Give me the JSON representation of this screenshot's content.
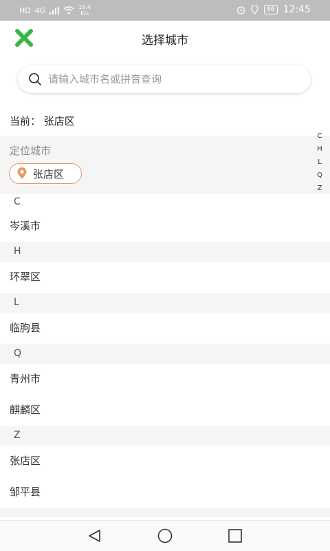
{
  "status": {
    "network": "HD",
    "signal": "4G",
    "speed_value": "19.4",
    "speed_unit": "K/s",
    "battery": "86",
    "time": "12:45"
  },
  "header": {
    "title": "选择城市",
    "close_icon": "close-x-icon",
    "close_color": "#39b54a"
  },
  "search": {
    "placeholder": "请输入城市名或拼音查询",
    "value": ""
  },
  "current": {
    "text": "当前：  张店区"
  },
  "locate": {
    "label": "定位城市",
    "city": "张店区",
    "accent": "#e79a6a"
  },
  "sections": [
    {
      "letter": "C",
      "cities": [
        "岑溪市"
      ]
    },
    {
      "letter": "H",
      "cities": [
        "环翠区"
      ]
    },
    {
      "letter": "L",
      "cities": [
        "临朐县"
      ]
    },
    {
      "letter": "Q",
      "cities": [
        "青州市",
        "麒麟区"
      ]
    },
    {
      "letter": "Z",
      "cities": [
        "张店区",
        "邹平县"
      ]
    }
  ],
  "index": [
    "C",
    "H",
    "L",
    "Q",
    "Z"
  ]
}
